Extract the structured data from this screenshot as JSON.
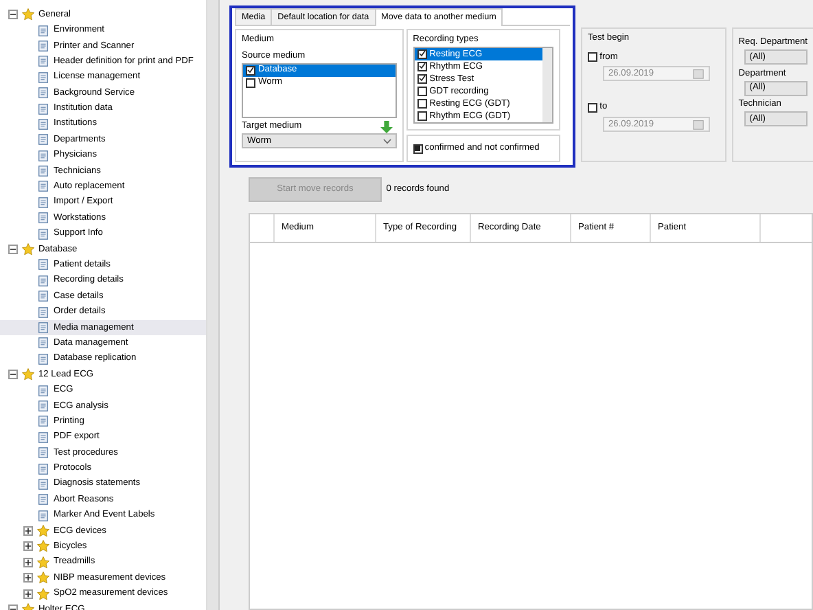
{
  "tree": [
    {
      "label": "General",
      "kind": "folder",
      "expanded": true,
      "selected": false,
      "children": [
        {
          "label": "Environment",
          "kind": "item",
          "selected": false
        },
        {
          "label": "Printer and Scanner",
          "kind": "item",
          "selected": false
        },
        {
          "label": "Header definition for print and PDF",
          "kind": "item",
          "selected": false
        },
        {
          "label": "License management",
          "kind": "item",
          "selected": false
        },
        {
          "label": "Background Service",
          "kind": "item",
          "selected": false
        },
        {
          "label": "Institution data",
          "kind": "item",
          "selected": false
        },
        {
          "label": "Institutions",
          "kind": "item",
          "selected": false
        },
        {
          "label": "Departments",
          "kind": "item",
          "selected": false
        },
        {
          "label": "Physicians",
          "kind": "item",
          "selected": false
        },
        {
          "label": "Technicians",
          "kind": "item",
          "selected": false
        },
        {
          "label": "Auto replacement",
          "kind": "item",
          "selected": false
        },
        {
          "label": "Import / Export",
          "kind": "item",
          "selected": false
        },
        {
          "label": "Workstations",
          "kind": "item",
          "selected": false
        },
        {
          "label": "Support Info",
          "kind": "item",
          "selected": false
        }
      ]
    },
    {
      "label": "Database",
      "kind": "folder",
      "expanded": true,
      "selected": false,
      "children": [
        {
          "label": "Patient details",
          "kind": "item",
          "selected": false
        },
        {
          "label": "Recording details",
          "kind": "item",
          "selected": false
        },
        {
          "label": "Case details",
          "kind": "item",
          "selected": false
        },
        {
          "label": "Order details",
          "kind": "item",
          "selected": false
        },
        {
          "label": "Media management",
          "kind": "item",
          "selected": true
        },
        {
          "label": "Data management",
          "kind": "item",
          "selected": false
        },
        {
          "label": "Database replication",
          "kind": "item",
          "selected": false
        }
      ]
    },
    {
      "label": "12 Lead ECG",
      "kind": "folder",
      "expanded": true,
      "selected": false,
      "children": [
        {
          "label": "ECG",
          "kind": "item",
          "selected": false
        },
        {
          "label": "ECG analysis",
          "kind": "item",
          "selected": false
        },
        {
          "label": "Printing",
          "kind": "item",
          "selected": false
        },
        {
          "label": "PDF export",
          "kind": "item",
          "selected": false
        },
        {
          "label": "Test procedures",
          "kind": "item",
          "selected": false
        },
        {
          "label": "Protocols",
          "kind": "item",
          "selected": false
        },
        {
          "label": "Diagnosis statements",
          "kind": "item",
          "selected": false
        },
        {
          "label": "Abort Reasons",
          "kind": "item",
          "selected": false
        },
        {
          "label": "Marker And Event Labels",
          "kind": "item",
          "selected": false
        },
        {
          "label": "ECG devices",
          "kind": "folder",
          "expanded": false,
          "selected": false
        },
        {
          "label": "Bicycles",
          "kind": "folder",
          "expanded": false,
          "selected": false
        },
        {
          "label": "Treadmills",
          "kind": "folder",
          "expanded": false,
          "selected": false
        },
        {
          "label": "NIBP measurement devices",
          "kind": "folder",
          "expanded": false,
          "selected": false
        },
        {
          "label": "SpO2 measurement devices",
          "kind": "folder",
          "expanded": false,
          "selected": false
        }
      ]
    },
    {
      "label": "Holter ECG",
      "kind": "folder",
      "expanded": true,
      "selected": false
    }
  ],
  "tabs": [
    {
      "label": "Media",
      "selected": false
    },
    {
      "label": "Default location for data",
      "selected": false
    },
    {
      "label": "Move data to another medium",
      "selected": true
    }
  ],
  "medium": {
    "title": "Medium",
    "source_label": "Source medium",
    "sources": [
      {
        "label": "Database",
        "checked": true,
        "selected": true
      },
      {
        "label": "Worm",
        "checked": false,
        "selected": false
      }
    ],
    "target_label": "Target medium",
    "target_value": "Worm"
  },
  "recording_types": {
    "title": "Recording types",
    "items": [
      {
        "label": "Resting ECG",
        "checked": true,
        "selected": true
      },
      {
        "label": "Rhythm ECG",
        "checked": true,
        "selected": false
      },
      {
        "label": "Stress Test",
        "checked": true,
        "selected": false
      },
      {
        "label": "GDT recording",
        "checked": false,
        "selected": false
      },
      {
        "label": "Resting ECG (GDT)",
        "checked": false,
        "selected": false
      },
      {
        "label": "Rhythm ECG (GDT)",
        "checked": false,
        "selected": false
      }
    ]
  },
  "confirmed": {
    "label": "confirmed and not confirmed",
    "indeterminate": true
  },
  "test_begin": {
    "title": "Test begin",
    "from": {
      "label": "from",
      "checked": false,
      "value": "26.09.2019"
    },
    "to": {
      "label": "to",
      "checked": false,
      "value": "26.09.2019"
    }
  },
  "filters": [
    {
      "label": "Req. Department",
      "value": "(All)"
    },
    {
      "label": "Department",
      "value": "(All)"
    },
    {
      "label": "Technician",
      "value": "(All)"
    }
  ],
  "start_button": {
    "label": "Start move records",
    "disabled": true
  },
  "records_found": "0 records found",
  "table": {
    "columns": [
      "Medium",
      "Type of Recording",
      "Recording Date",
      "Patient #",
      "Patient"
    ]
  }
}
